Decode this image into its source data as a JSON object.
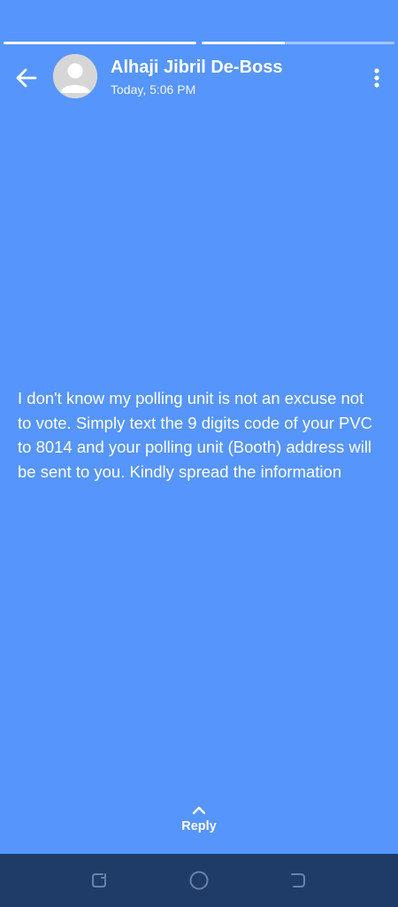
{
  "story": {
    "segments": [
      {
        "name": "segment-1",
        "progress": 1.0
      },
      {
        "name": "segment-2",
        "progress": 0.43
      }
    ]
  },
  "header": {
    "back_icon": "arrow-left-icon",
    "avatar_icon": "default-avatar-icon",
    "sender": "Alhaji Jibril De-Boss",
    "timestamp": "Today, 5:06 PM",
    "menu_icon": "more-vertical-icon"
  },
  "message": {
    "text": "I don't know my polling unit is not an excuse not to vote. Simply text the 9 digits code of your PVC to 8014 and your polling unit (Booth) address will be sent to you. Kindly spread the information"
  },
  "reply": {
    "icon": "chevron-up-icon",
    "label": "Reply"
  },
  "colors": {
    "background": "#5695fb",
    "navbar": "#1f3c68",
    "text": "#ffffff"
  },
  "navbar": {
    "recents_icon": "recents-icon",
    "home_icon": "home-circle-icon",
    "back_icon": "system-back-icon"
  }
}
